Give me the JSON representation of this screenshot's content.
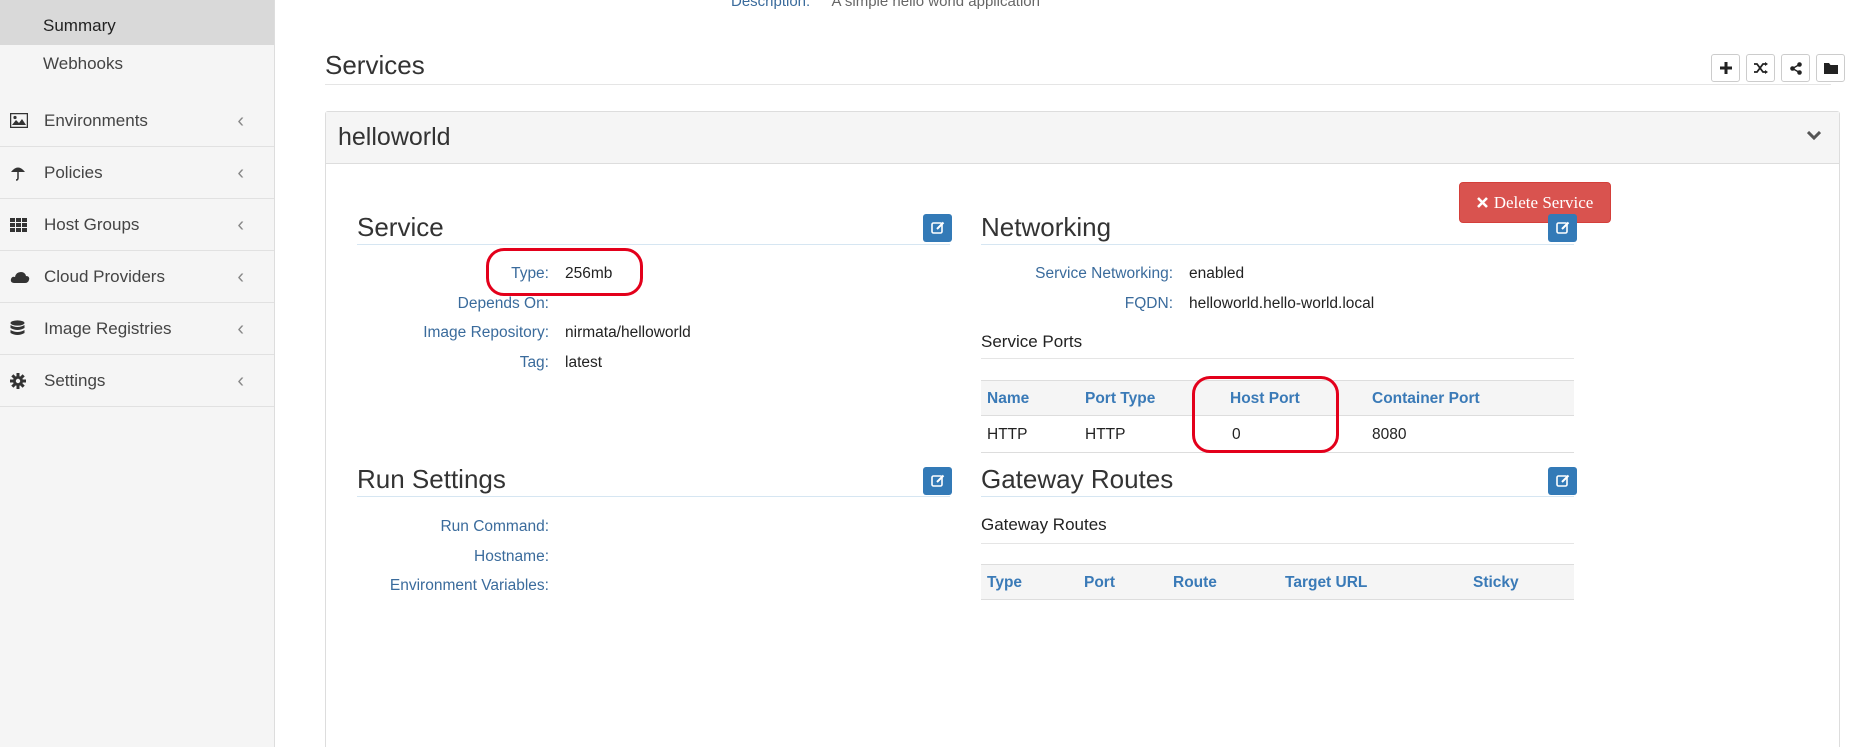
{
  "sidebar": {
    "sub_items": [
      {
        "label": "Summary",
        "active": true
      },
      {
        "label": "Webhooks",
        "active": false
      }
    ],
    "nav_items": [
      {
        "label": "Environments",
        "icon": "image-icon"
      },
      {
        "label": "Policies",
        "icon": "umbrella-icon"
      },
      {
        "label": "Host Groups",
        "icon": "grid-icon"
      },
      {
        "label": "Cloud Providers",
        "icon": "cloud-icon"
      },
      {
        "label": "Image Registries",
        "icon": "database-icon"
      },
      {
        "label": "Settings",
        "icon": "gear-icon"
      }
    ]
  },
  "header": {
    "description_label": "Description:",
    "description_value": "A simple hello world application"
  },
  "services": {
    "title": "Services",
    "toolbar_icons": [
      "plus-icon",
      "shuffle-icon",
      "share-icon",
      "folder-icon"
    ],
    "panel": {
      "title": "helloworld",
      "delete_label": "Delete Service",
      "service": {
        "title": "Service",
        "fields": [
          {
            "label": "Type:",
            "value": "256mb"
          },
          {
            "label": "Depends On:",
            "value": ""
          },
          {
            "label": "Image Repository:",
            "value": "nirmata/helloworld"
          },
          {
            "label": "Tag:",
            "value": "latest"
          }
        ]
      },
      "networking": {
        "title": "Networking",
        "fields": [
          {
            "label": "Service Networking:",
            "value": "enabled"
          },
          {
            "label": "FQDN:",
            "value": "helloworld.hello-world.local"
          }
        ],
        "ports_title": "Service Ports",
        "ports_columns": [
          "Name",
          "Port Type",
          "Host Port",
          "Container Port"
        ],
        "ports_rows": [
          [
            "HTTP",
            "HTTP",
            "0",
            "8080"
          ]
        ]
      },
      "run_settings": {
        "title": "Run Settings",
        "fields": [
          {
            "label": "Run Command:",
            "value": ""
          },
          {
            "label": "Hostname:",
            "value": ""
          },
          {
            "label": "Environment Variables:",
            "value": ""
          }
        ]
      },
      "gateway": {
        "title": "Gateway Routes",
        "subtitle": "Gateway Routes",
        "columns": [
          "Type",
          "Port",
          "Route",
          "Target URL",
          "Sticky"
        ]
      }
    }
  },
  "colors": {
    "accent": "#337ab7",
    "danger": "#d9534f",
    "highlight": "#e3001b"
  }
}
